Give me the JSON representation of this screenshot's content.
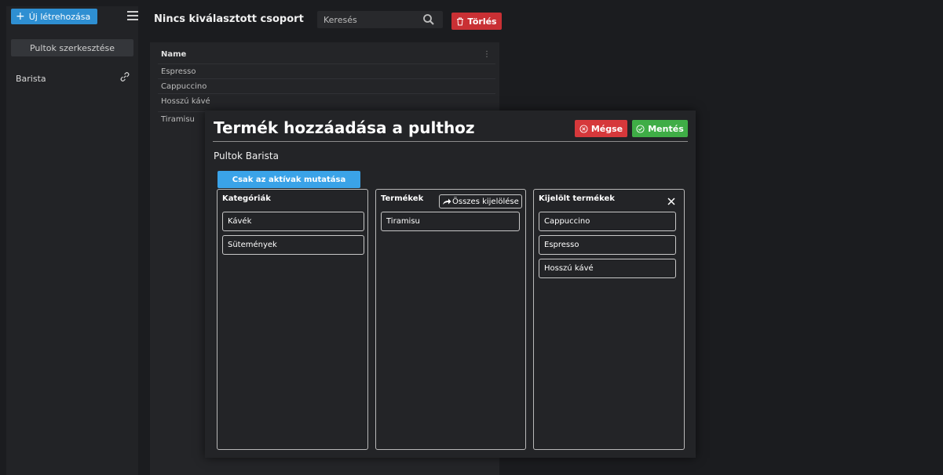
{
  "sidebar": {
    "new_label": "Új létrehozása",
    "edit_counters_label": "Pultok szerkesztése",
    "items": [
      {
        "label": "Barista"
      }
    ]
  },
  "header": {
    "title": "Nincs kiválasztott csoport",
    "search_placeholder": "Keresés",
    "delete_label": "Törlés"
  },
  "table": {
    "column_name": "Name",
    "rows": [
      "Espresso",
      "Cappuccino",
      "Hosszú kávé",
      "Tiramisu"
    ]
  },
  "modal": {
    "title": "Termék hozzáadása a pulthoz",
    "cancel_label": "Mégse",
    "save_label": "Mentés",
    "subtitle": "Pultok Barista",
    "show_active_label": "Csak az aktívak mutatása",
    "categories": {
      "title": "Kategóriák",
      "items": [
        "Kávék",
        "Sütemények"
      ]
    },
    "products": {
      "title": "Termékek",
      "select_all_label": "Összes kijelölése",
      "items": [
        "Tiramisu"
      ]
    },
    "selected": {
      "title": "Kijelölt termékek",
      "items": [
        "Cappuccino",
        "Espresso",
        "Hosszú kávé"
      ]
    }
  },
  "colors": {
    "primary": "#2e8fd2",
    "danger": "#d6383b",
    "success": "#3fad46",
    "background": "#1b1c1f"
  }
}
